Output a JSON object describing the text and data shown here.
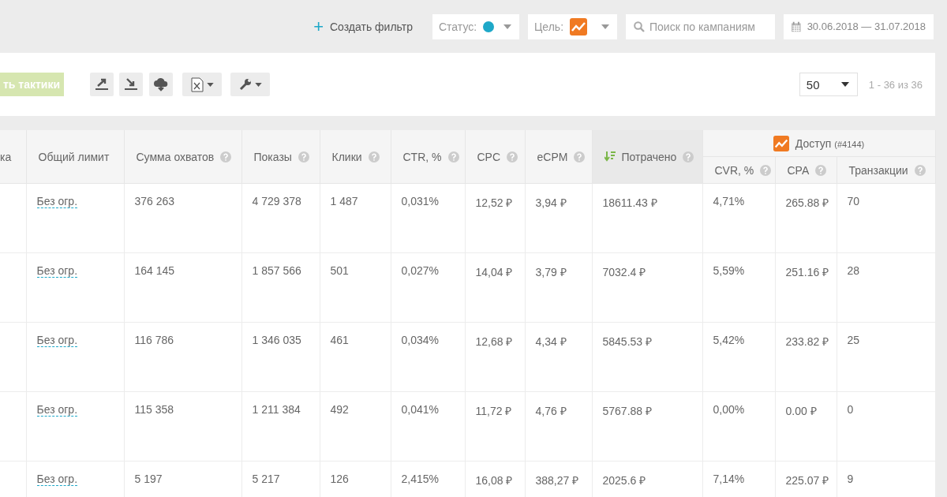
{
  "filter_bar": {
    "create_filter": {
      "icon": "+",
      "label": "Создать фильтр"
    },
    "status": {
      "label": "Статус:",
      "color": "#1ea8c8"
    },
    "goal": {
      "label": "Цель:"
    },
    "search": {
      "placeholder": "Поиск по кампаниям"
    },
    "date_range": "30.06.2018 — 31.07.2018"
  },
  "toolbar": {
    "tactics_button": "ть тактики",
    "page_size": "50",
    "pagination": "1 - 36 из 36"
  },
  "table": {
    "columns": [
      {
        "label": "ка",
        "help": false,
        "sorted": false
      },
      {
        "label": "Общий лимит",
        "help": false,
        "sorted": false
      },
      {
        "label": "Сумма охватов",
        "help": true,
        "sorted": false
      },
      {
        "label": "Показы",
        "help": true,
        "sorted": false
      },
      {
        "label": "Клики",
        "help": true,
        "sorted": false
      },
      {
        "label": "CTR, %",
        "help": true,
        "sorted": false
      },
      {
        "label": "CPC",
        "help": true,
        "sorted": false
      },
      {
        "label": "eCPM",
        "help": true,
        "sorted": false
      },
      {
        "label": "Потрачено",
        "help": true,
        "sorted": true
      }
    ],
    "goal_group": {
      "title": "Доступ",
      "id": "(#4144)",
      "columns": [
        {
          "label": "CVR, %",
          "help": true
        },
        {
          "label": "CPA",
          "help": true
        },
        {
          "label": "Транзакции",
          "help": true
        }
      ]
    },
    "rows": [
      [
        "",
        "Без огр.",
        "376 263",
        "4 729 378",
        "1 487",
        "0,031%",
        "12,52 ₽",
        "3,94 ₽",
        "18611.43 ₽",
        "4,71%",
        "265.88 ₽",
        "70"
      ],
      [
        "",
        "Без огр.",
        "164 145",
        "1 857 566",
        "501",
        "0,027%",
        "14,04 ₽",
        "3,79 ₽",
        "7032.4 ₽",
        "5,59%",
        "251.16 ₽",
        "28"
      ],
      [
        "",
        "Без огр.",
        "116 786",
        "1 346 035",
        "461",
        "0,034%",
        "12,68 ₽",
        "4,34 ₽",
        "5845.53 ₽",
        "5,42%",
        "233.82 ₽",
        "25"
      ],
      [
        "",
        "Без огр.",
        "115 358",
        "1 211 384",
        "492",
        "0,041%",
        "11,72 ₽",
        "4,76 ₽",
        "5767.88 ₽",
        "0,00%",
        "0.00 ₽",
        "0"
      ],
      [
        "",
        "Без огр.",
        "5 197",
        "5 217",
        "126",
        "2,415%",
        "16,08 ₽",
        "388,27 ₽",
        "2025.6 ₽",
        "7,14%",
        "225.07 ₽",
        "9"
      ]
    ]
  }
}
